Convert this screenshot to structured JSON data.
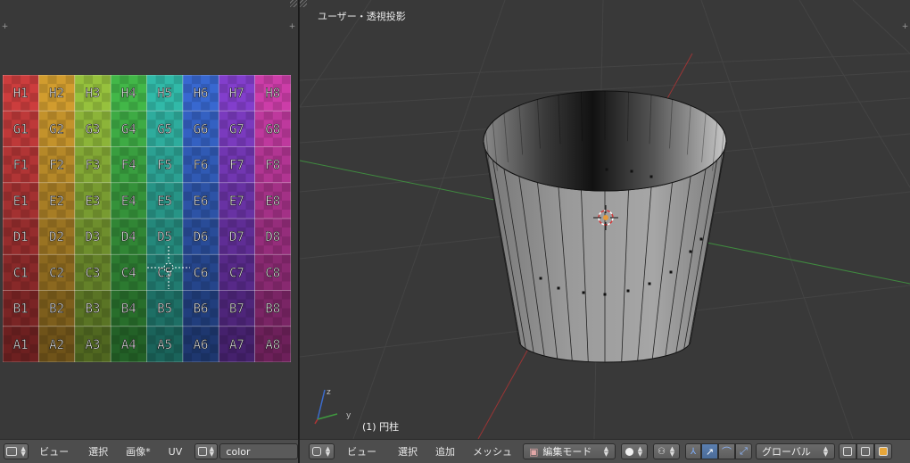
{
  "uv_editor": {
    "header": {
      "menus": [
        "ビュー",
        "選択",
        "画像*",
        "UV"
      ],
      "image_name": "color"
    },
    "grid": {
      "rows": [
        "H",
        "G",
        "F",
        "E",
        "D",
        "C",
        "B",
        "A"
      ],
      "cols": [
        "1",
        "2",
        "3",
        "4",
        "5",
        "6",
        "7",
        "8"
      ],
      "col_colors": [
        "#c23a3a",
        "#c7952c",
        "#8fb83a",
        "#3fae45",
        "#2fb0a0",
        "#3563c6",
        "#7c3bc2",
        "#c23aa0"
      ]
    }
  },
  "viewport": {
    "title": "ユーザー・透視投影",
    "object_label": "(1) 円柱",
    "axis_labels": {
      "y": "y",
      "z": "z"
    },
    "header": {
      "menus": [
        "ビュー",
        "選択",
        "追加",
        "メッシュ"
      ],
      "mode": "編集モード",
      "orientation": "グローバル"
    }
  }
}
